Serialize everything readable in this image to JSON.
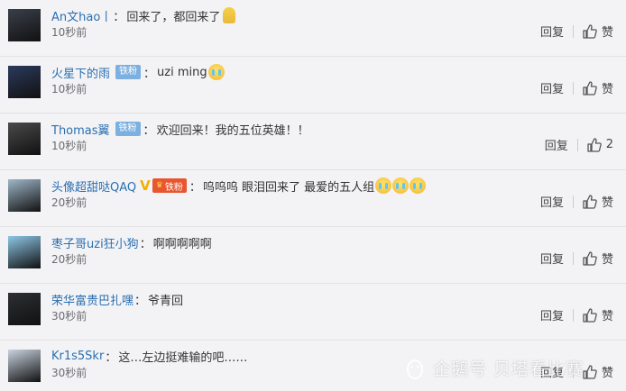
{
  "comments": [
    {
      "user": "An文hao丨",
      "badge": "",
      "text": "回来了，都回来了",
      "time": "10秒前",
      "reply": "回复",
      "like": "赞",
      "avatar_color": "#3a3f4a",
      "emoji": "dog"
    },
    {
      "user": "火星下的雨",
      "badge": "铁粉",
      "text": "uzi ming",
      "time": "10秒前",
      "reply": "回复",
      "like": "赞",
      "avatar_color": "#2b3a5c",
      "emoji": "cry"
    },
    {
      "user": "Thomas翼",
      "badge": "铁粉",
      "text": "欢迎回来！我的五位英雄！！",
      "time": "10秒前",
      "reply": "回复",
      "like": "2",
      "avatar_color": "#4a4a4a",
      "emoji": ""
    },
    {
      "user": "头像超甜哒QAQ",
      "badge": "铁粉",
      "text": "呜呜呜 眼泪回来了 最爱的五人组",
      "time": "20秒前",
      "reply": "回复",
      "like": "赞",
      "avatar_color": "#9fb7c9",
      "emoji": "cry3"
    },
    {
      "user": "枣子哥uzi狂小狗",
      "badge": "",
      "text": "啊啊啊啊啊",
      "time": "20秒前",
      "reply": "回复",
      "like": "赞",
      "avatar_color": "#8ec7e6",
      "emoji": ""
    },
    {
      "user": "荣华富贵巴扎嘿",
      "badge": "",
      "text": "爷青回",
      "time": "30秒前",
      "reply": "回复",
      "like": "赞",
      "avatar_color": "#2d2f33",
      "emoji": ""
    },
    {
      "user": "Kr1s5Skr",
      "badge": "",
      "text": "这…左边挺难输的吧……",
      "time": "30秒前",
      "reply": "回复",
      "like": "赞",
      "avatar_color": "#c9d3e0",
      "emoji": ""
    }
  ],
  "vip_mark": "V",
  "watermark": "企鹅号 贝塔看比赛"
}
